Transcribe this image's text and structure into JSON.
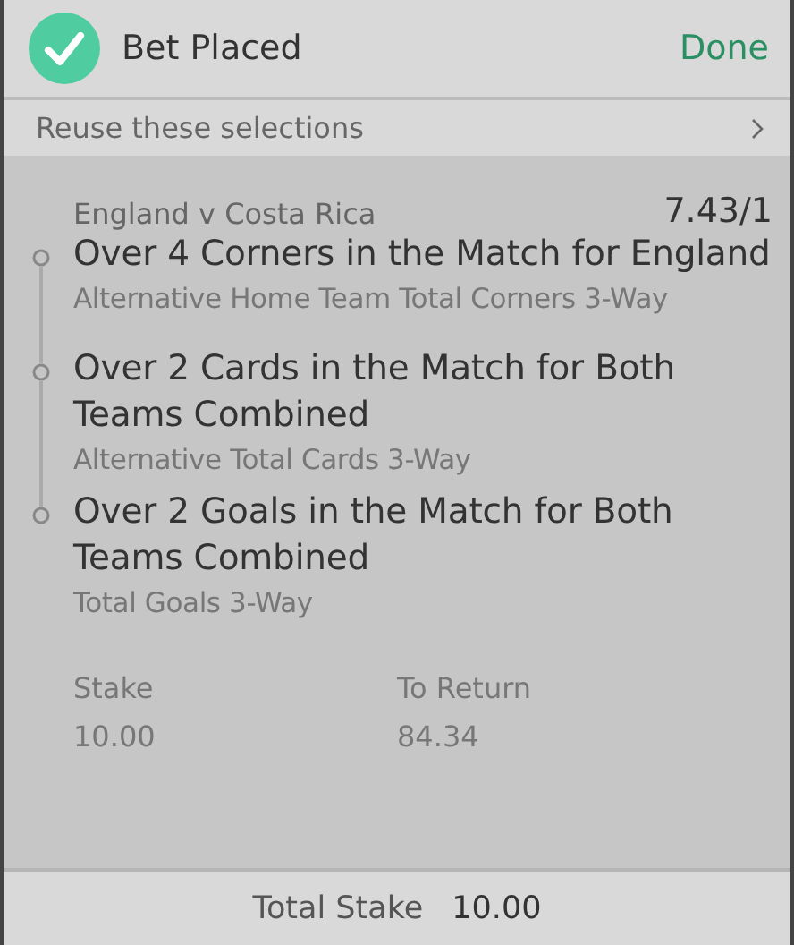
{
  "header": {
    "title": "Bet Placed",
    "done": "Done"
  },
  "reuse": {
    "label": "Reuse these selections"
  },
  "bet": {
    "event": "England v Costa Rica",
    "odds": "7.43/1",
    "legs": [
      {
        "selection": "Over 4 Corners in the Match for England",
        "market": "Alternative Home Team Total Corners 3-Way"
      },
      {
        "selection": "Over 2 Cards in the Match for Both Teams Combined",
        "market": "Alternative Total Cards 3-Way"
      },
      {
        "selection": "Over 2 Goals in the Match for Both Teams Combined",
        "market": "Total Goals 3-Way"
      }
    ],
    "stake_label": "Stake",
    "stake": "10.00",
    "return_label": "To Return",
    "return": "84.34"
  },
  "footer": {
    "label": "Total Stake",
    "value": "10.00"
  }
}
